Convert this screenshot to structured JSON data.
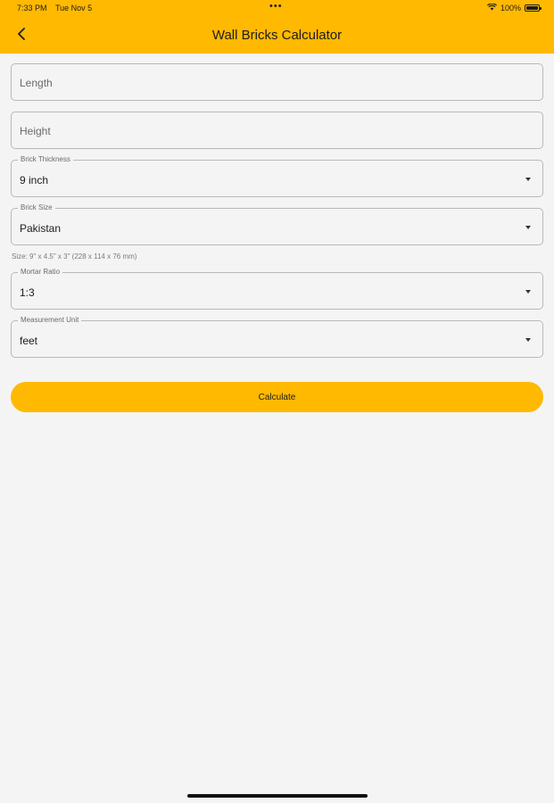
{
  "status_bar": {
    "time": "7:33 PM",
    "date": "Tue Nov 5",
    "dots": "•••",
    "battery": "100%"
  },
  "header": {
    "title": "Wall Bricks Calculator",
    "back_icon": "chevron-left-icon"
  },
  "form": {
    "length": {
      "placeholder": "Length",
      "value": ""
    },
    "height": {
      "placeholder": "Height",
      "value": ""
    },
    "brick_thickness": {
      "label": "Brick Thickness",
      "value": "9 inch"
    },
    "brick_size": {
      "label": "Brick Size",
      "value": "Pakistan",
      "hint": "Size: 9\" x 4.5\" x 3\" (228 x 114 x 76 mm)"
    },
    "mortar_ratio": {
      "label": "Mortar Ratio",
      "value": "1:3"
    },
    "measurement_unit": {
      "label": "Measurement Unit",
      "value": "feet"
    }
  },
  "calculate_label": "Calculate",
  "colors": {
    "accent": "#ffb900",
    "background": "#f4f4f4",
    "border": "#b9b9b9"
  }
}
